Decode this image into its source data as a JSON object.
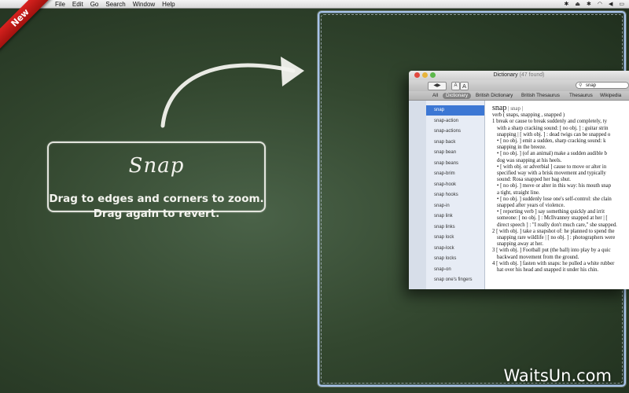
{
  "menubar": {
    "apple_icon": "apple-icon",
    "items": [
      "File",
      "Edit",
      "Go",
      "Search",
      "Window",
      "Help"
    ],
    "status_icons": [
      "dropbox-icon",
      "eject-icon",
      "bluetooth-icon",
      "wifi-icon",
      "volume-icon",
      "battery-icon"
    ]
  },
  "ribbon": {
    "label": "New",
    "color": "#c3161a"
  },
  "promo": {
    "title": "Snap",
    "line1": "Drag to edges and corners to zoom.",
    "line2": "Drag again to revert."
  },
  "dictionary": {
    "title": "Dictionary",
    "count": "(47 found)",
    "font_small": "A",
    "font_large": "A",
    "search_value": "snap",
    "scopes": [
      "All",
      "Dictionary",
      "British Dictionary",
      "British Thesaurus",
      "Thesaurus",
      "Wikipedia"
    ],
    "active_scope": "Dictionary",
    "words": [
      "snap",
      "snap-action",
      "snap-actions",
      "snap back",
      "snap bean",
      "snap beans",
      "snap-brim",
      "snap-hook",
      "snap hooks",
      "snap-in",
      "snap link",
      "snap links",
      "snap lock",
      "snap-lock",
      "snap locks",
      "snap-on",
      "snap one's fingers"
    ],
    "selected_word": "snap",
    "entry": {
      "headword": "snap",
      "pron": "| snap |",
      "pos_line": "verb ( snaps, snapping , snapped )",
      "d1a": "1 break or cause to break suddenly and completely, ty",
      "d1b": "with a sharp cracking sound: [ no obj. ] : guitar strin",
      "d1c": "snapping | [ with obj. ] : dead twigs can be snapped o",
      "d1d": "• [ no obj. ] emit a sudden, sharp cracking sound: k",
      "d1e": "snapping in the breeze.",
      "d1f": "• [ no obj. ] (of an animal) make a sudden audible b",
      "d1g": "dog was snapping at his heels.",
      "d1h": "• [ with obj. or adverbial ] cause to move or alter in",
      "d1i": "specified way with a brisk movement and typically",
      "d1j": "sound: Rosa snapped her bag shut.",
      "d1k": "• [ no obj. ] move or alter in this way: his mouth snap",
      "d1l": "a tight, straight line.",
      "d1m": "• [ no obj. ] suddenly lose one's self-control: she clain",
      "d1n": "snapped after years of violence.",
      "d1o": "• [ reporting verb ] say something quickly and irrit",
      "d1p": "someone: [ no obj. ] : McIlvanney snapped at her | [",
      "d1q": "direct speech ] : \"I really don't much care,\" she snapped.",
      "d2a": "2 [ with obj. ] take a snapshot of: he planned to spend the",
      "d2b": "snapping rare wildlife | [ no obj. ] : photographers were",
      "d2c": "snapping away at her.",
      "d3a": "3 [ with obj. ] Football put (the ball) into play by a quic",
      "d3b": "backward movement from the ground.",
      "d4a": "4 [ with obj. ] fasten with snaps: he pulled a white rubber",
      "d4b": "hat over his head and snapped it under his chin."
    }
  },
  "watermark": "WaitsUn.com",
  "colors": {
    "chalkboard": "#33472f",
    "snap_outline": "#a9c4ea",
    "selection": "#3c77d4"
  }
}
